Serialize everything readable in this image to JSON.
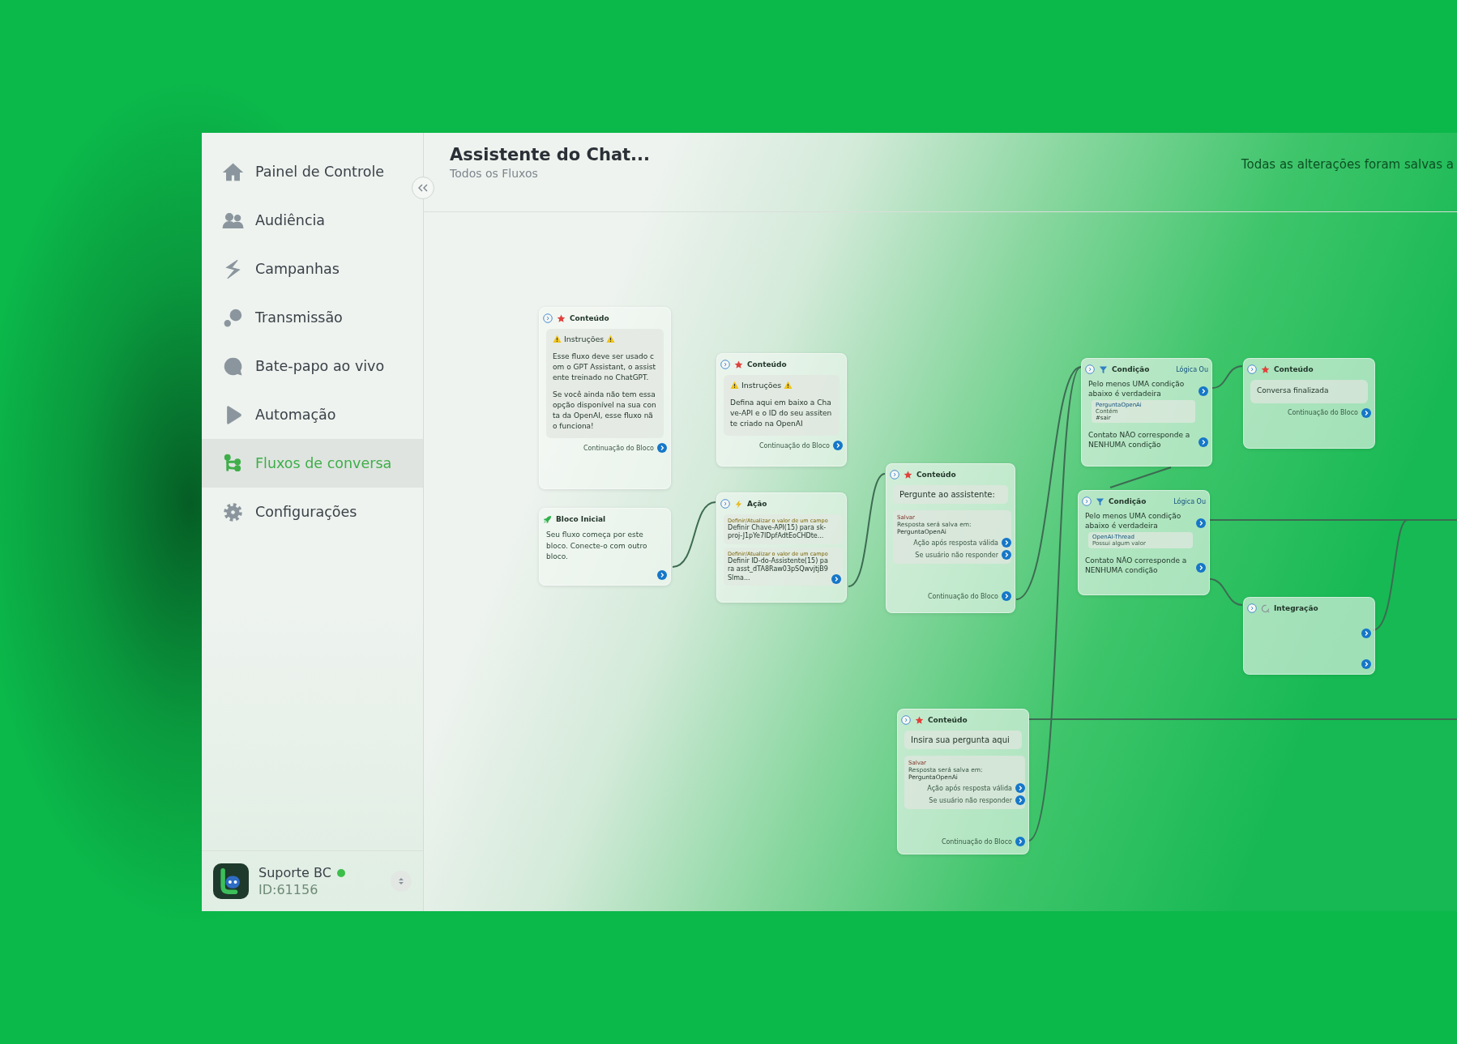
{
  "sidebar": {
    "items": [
      {
        "label": "Painel de Controle",
        "selected": false
      },
      {
        "label": "Audiência",
        "selected": false
      },
      {
        "label": "Campanhas",
        "selected": false
      },
      {
        "label": "Transmissão",
        "selected": false
      },
      {
        "label": "Bate-papo ao vivo",
        "selected": false
      },
      {
        "label": "Automação",
        "selected": false
      },
      {
        "label": "Fluxos de conversa",
        "selected": true
      },
      {
        "label": "Configurações",
        "selected": false
      }
    ],
    "account": {
      "name": "Suporte BC",
      "id": "ID:61156",
      "online": true
    }
  },
  "header": {
    "title": "Assistente do Chat...",
    "subtitle": "Todos os Fluxos",
    "save_status": "Todas as alterações foram salvas a"
  },
  "canvas": {
    "nodes": [
      {
        "kind": "content",
        "title": "Conteúdo",
        "heading": "Instruções",
        "paragraphs": [
          "Esse fluxo deve ser usado com o GPT Assistant, o assistente treinado no ChatGPT.",
          "Se você ainda não tem essa opção disponível na sua conta da OpenAI, esse fluxo não funciona!"
        ],
        "footer": "Continuação do Bloco"
      },
      {
        "kind": "content",
        "title": "Conteúdo",
        "heading": "Instruções",
        "paragraphs": [
          "Defina aqui em baixo a Chave-API e o ID do seu assitente criado na OpenAI"
        ],
        "footer": "Continuação do Bloco"
      },
      {
        "kind": "start",
        "title": "Bloco Inicial",
        "text": "Seu fluxo começa por este bloco. Conecte-o com outro bloco."
      },
      {
        "kind": "action",
        "title": "Ação",
        "actions": [
          {
            "label": "Definir/Atualizar o valor de um campo",
            "text": "Definir Chave-API(15) para sk-proj-J1pYe7IDpfAdtEoCHDte..."
          },
          {
            "label": "Definir/Atualizar o valor de um campo",
            "text": "Definir ID-do-Assistente(15) para asst_dTA8Raw03pSQwvjtjB9Slma..."
          }
        ]
      },
      {
        "kind": "question",
        "title": "Conteúdo",
        "question": "Pergunte ao assistente:",
        "save_label": "Salvar",
        "save_text": "Resposta será salva em:",
        "variable": "PerguntaOpenAi",
        "outputs": [
          "Ação após resposta válida",
          "Se usuário não responder"
        ],
        "footer": "Continuação do Bloco"
      },
      {
        "kind": "condition",
        "title": "Condição",
        "logic": "Lógica Ou",
        "match": "Pelo menos UMA condição abaixo é verdadeira",
        "rule": {
          "field": "PerguntaOpenAi",
          "operator": "Contém",
          "value": "#sair"
        },
        "fallback": "Contato NÃO corresponde a NENHUMA condição"
      },
      {
        "kind": "condition",
        "title": "Condição",
        "logic": "Lógica Ou",
        "match": "Pelo menos UMA condição abaixo é verdadeira",
        "rule": {
          "field": "OpenAI-Thread",
          "operator": "Possui algum valor"
        },
        "fallback": "Contato NÃO corresponde a NENHUMA condição"
      },
      {
        "kind": "content",
        "title": "Conteúdo",
        "paragraphs": [
          "Conversa finalizada"
        ],
        "footer": "Continuação do Bloco"
      },
      {
        "kind": "integration",
        "title": "Integração"
      },
      {
        "kind": "question",
        "title": "Conteúdo",
        "question": "Insira sua pergunta aqui",
        "save_label": "Salvar",
        "save_text": "Resposta será salva em:",
        "variable": "PerguntaOpenAi",
        "outputs": [
          "Ação após resposta válida",
          "Se usuário não responder"
        ],
        "footer": "Continuação do Bloco"
      }
    ]
  }
}
